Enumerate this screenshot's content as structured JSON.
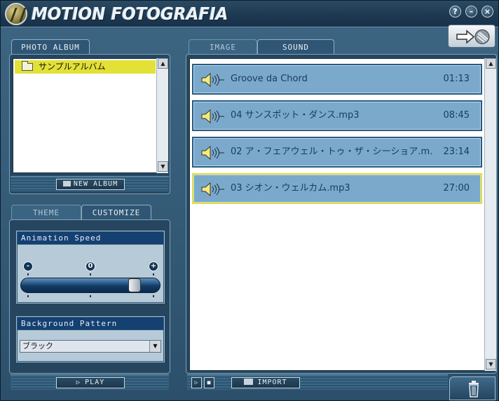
{
  "app": {
    "title": "MOTION FOTOGRAFIA"
  },
  "window_buttons": {
    "help": "?",
    "minimize": "–",
    "close": "×"
  },
  "album_panel": {
    "tab_label": "PHOTO ALBUM",
    "items": [
      {
        "label": "サンプルアルバム",
        "selected": true
      }
    ],
    "new_album_label": "NEW ALBUM"
  },
  "customize_panel": {
    "tabs": [
      {
        "label": "THEME",
        "active": false
      },
      {
        "label": "CUSTOMIZE",
        "active": true
      }
    ],
    "animation_speed": {
      "label": "Animation Speed",
      "minus": "-",
      "zero": "0",
      "plus": "+",
      "value_fraction": 0.86
    },
    "background_pattern": {
      "label": "Background Pattern",
      "selected": "ブラック"
    },
    "play_label": "PLAY"
  },
  "media_panel": {
    "tabs": [
      {
        "label": "IMAGE",
        "active": false
      },
      {
        "label": "SOUND",
        "active": true
      }
    ],
    "sounds": [
      {
        "name": "Groove da Chord",
        "duration": "01:13",
        "selected": false
      },
      {
        "name": "04 サンスポット・ダンス.mp3",
        "duration": "08:45",
        "selected": false
      },
      {
        "name": "02 ア・フェアウェル・トゥ・ザ・シーショア.m…",
        "duration": "23:14",
        "selected": false
      },
      {
        "name": "03 シオン・ウェルカム.mp3",
        "duration": "27:00",
        "selected": true
      }
    ],
    "import_label": "IMPORT"
  },
  "colors": {
    "accent": "#144072",
    "selection": "#e3e036",
    "row_bg": "#7ba9cb",
    "selected_border": "#e5dd37"
  }
}
